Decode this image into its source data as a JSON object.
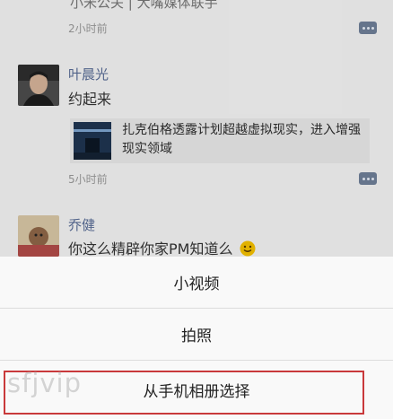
{
  "feed": {
    "partial_text": "小米公关 | 大嘴媒体联手",
    "post1_time": "2小时前",
    "post2": {
      "name": "叶晨光",
      "content": "约起来",
      "share_title": "扎克伯格透露计划超越虚拟现实，进入增强现实领域",
      "time": "5小时前"
    },
    "post3": {
      "name": "乔健",
      "content": "你这么精辟你家PM知道么"
    }
  },
  "action_sheet": {
    "items": [
      {
        "label": "小视频"
      },
      {
        "label": "拍照"
      },
      {
        "label": "从手机相册选择"
      }
    ]
  },
  "watermark": "sfjvip",
  "colors": {
    "name_blue": "#576b95",
    "highlight_red": "#c9393b"
  },
  "icons": [
    "comment-icon",
    "smile-emoji-icon"
  ]
}
